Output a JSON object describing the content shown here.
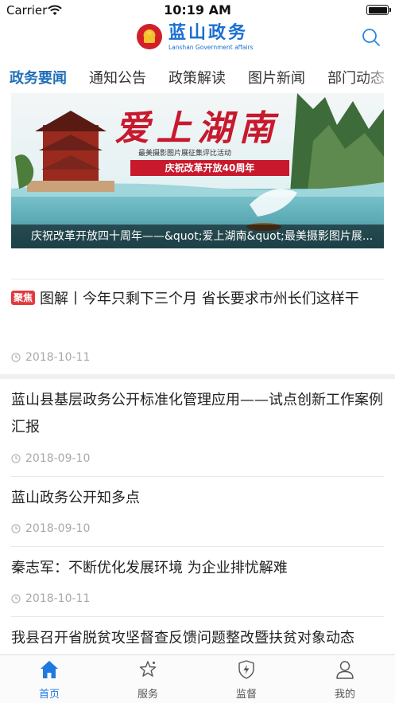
{
  "status_bar": {
    "carrier": "Carrier",
    "time": "10:19 AM"
  },
  "header": {
    "title": "蓝山政务",
    "subtitle": "Lanshan Government affairs",
    "search_icon": "search-icon",
    "brand_color": "#1a6fd1"
  },
  "tabs": [
    {
      "label": "政务要闻",
      "active": true
    },
    {
      "label": "通知公告",
      "active": false
    },
    {
      "label": "政策解读",
      "active": false
    },
    {
      "label": "图片新闻",
      "active": false
    },
    {
      "label": "部门动态",
      "active": false
    }
  ],
  "banner": {
    "title": "爱上湖南",
    "subtitle_small": "最美摄影图片展征集评比活动",
    "subtitle_red": "庆祝改革开放40周年",
    "caption": "庆祝改革开放四十周年——&quot;爱上湖南&quot;最美摄影图片展..."
  },
  "news": [
    {
      "badge": "聚焦",
      "title": "图解丨今年只剩下三个月 省长要求市州长们这样干",
      "date": "2018-10-11"
    },
    {
      "badge": "",
      "title": "蓝山县基层政务公开标准化管理应用——试点创新工作案例汇报",
      "date": "2018-09-10"
    },
    {
      "badge": "",
      "title": "蓝山政务公开知多点",
      "date": "2018-09-10"
    },
    {
      "badge": "",
      "title": "秦志军：不断优化发展环境 为企业排忧解难",
      "date": "2018-10-11"
    },
    {
      "badge": "",
      "title": "我县召开省脱贫攻坚督查反馈问题整改暨扶贫对象动态",
      "date": ""
    }
  ],
  "tabbar": [
    {
      "label": "首页",
      "icon": "home-icon",
      "active": true
    },
    {
      "label": "服务",
      "icon": "star-service-icon",
      "active": false
    },
    {
      "label": "监督",
      "icon": "shield-bolt-icon",
      "active": false
    },
    {
      "label": "我的",
      "icon": "user-icon",
      "active": false
    }
  ],
  "colors": {
    "active_tab": "#1f6fb8",
    "tabbar_active": "#1f7ae0",
    "badge": "#e0393e"
  }
}
